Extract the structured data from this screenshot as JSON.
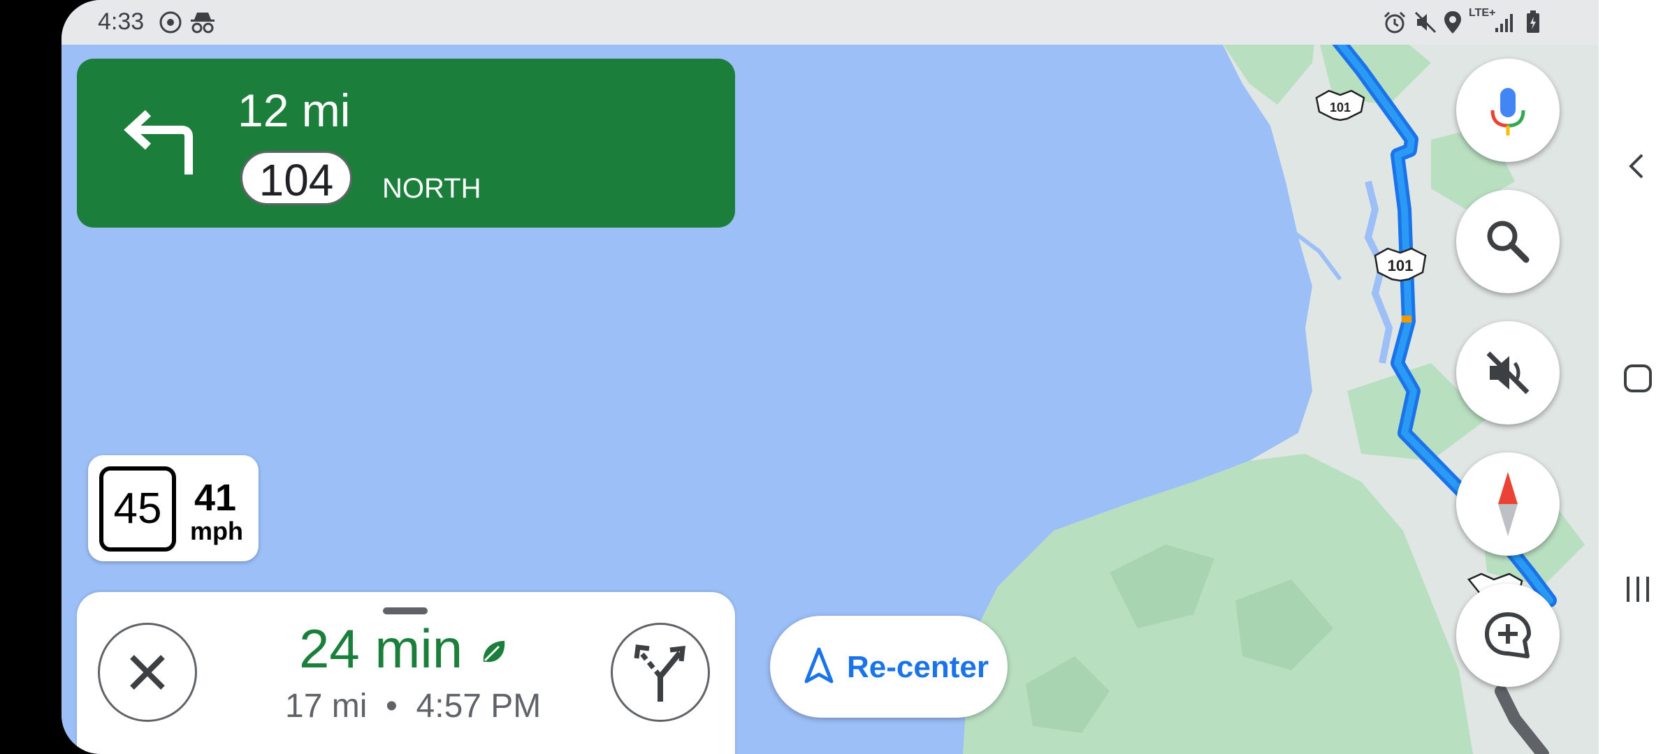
{
  "status_bar": {
    "time": "4:33",
    "left_icons": [
      "radio-icon",
      "incognito-icon"
    ],
    "right_icons": [
      "alarm-icon",
      "mute-icon",
      "location-icon",
      "lte-icon",
      "signal-icon",
      "battery-charging-icon"
    ],
    "network": "LTE+"
  },
  "turn_card": {
    "maneuver_icon": "turn-left-icon",
    "distance": "12 mi",
    "route_number": "104",
    "direction": "NORTH",
    "color": "#1b7f3b"
  },
  "speed": {
    "limit": "45",
    "current": "41",
    "unit": "mph"
  },
  "map": {
    "highway_shields": [
      "101",
      "101"
    ]
  },
  "trip": {
    "eta_minutes": "24 min",
    "distance": "17 mi",
    "arrival_time": "4:57 PM",
    "separator": "•",
    "eco_icon": "leaf-icon"
  },
  "buttons": {
    "close": "close-icon",
    "alternate_routes": "alternate-routes-icon",
    "recenter_label": "Re-center",
    "voice": "mic-icon",
    "search": "search-icon",
    "mute": "volume-off-icon",
    "compass": "compass-icon",
    "report": "add-report-icon"
  },
  "system_nav": [
    "back-icon",
    "home-icon",
    "recents-icon"
  ],
  "colors": {
    "water": "#9cbff7",
    "land": "#dfe6e3",
    "forest": "#b8dfc0",
    "route": "#1a73e8",
    "accent_green": "#1b7f3b"
  }
}
